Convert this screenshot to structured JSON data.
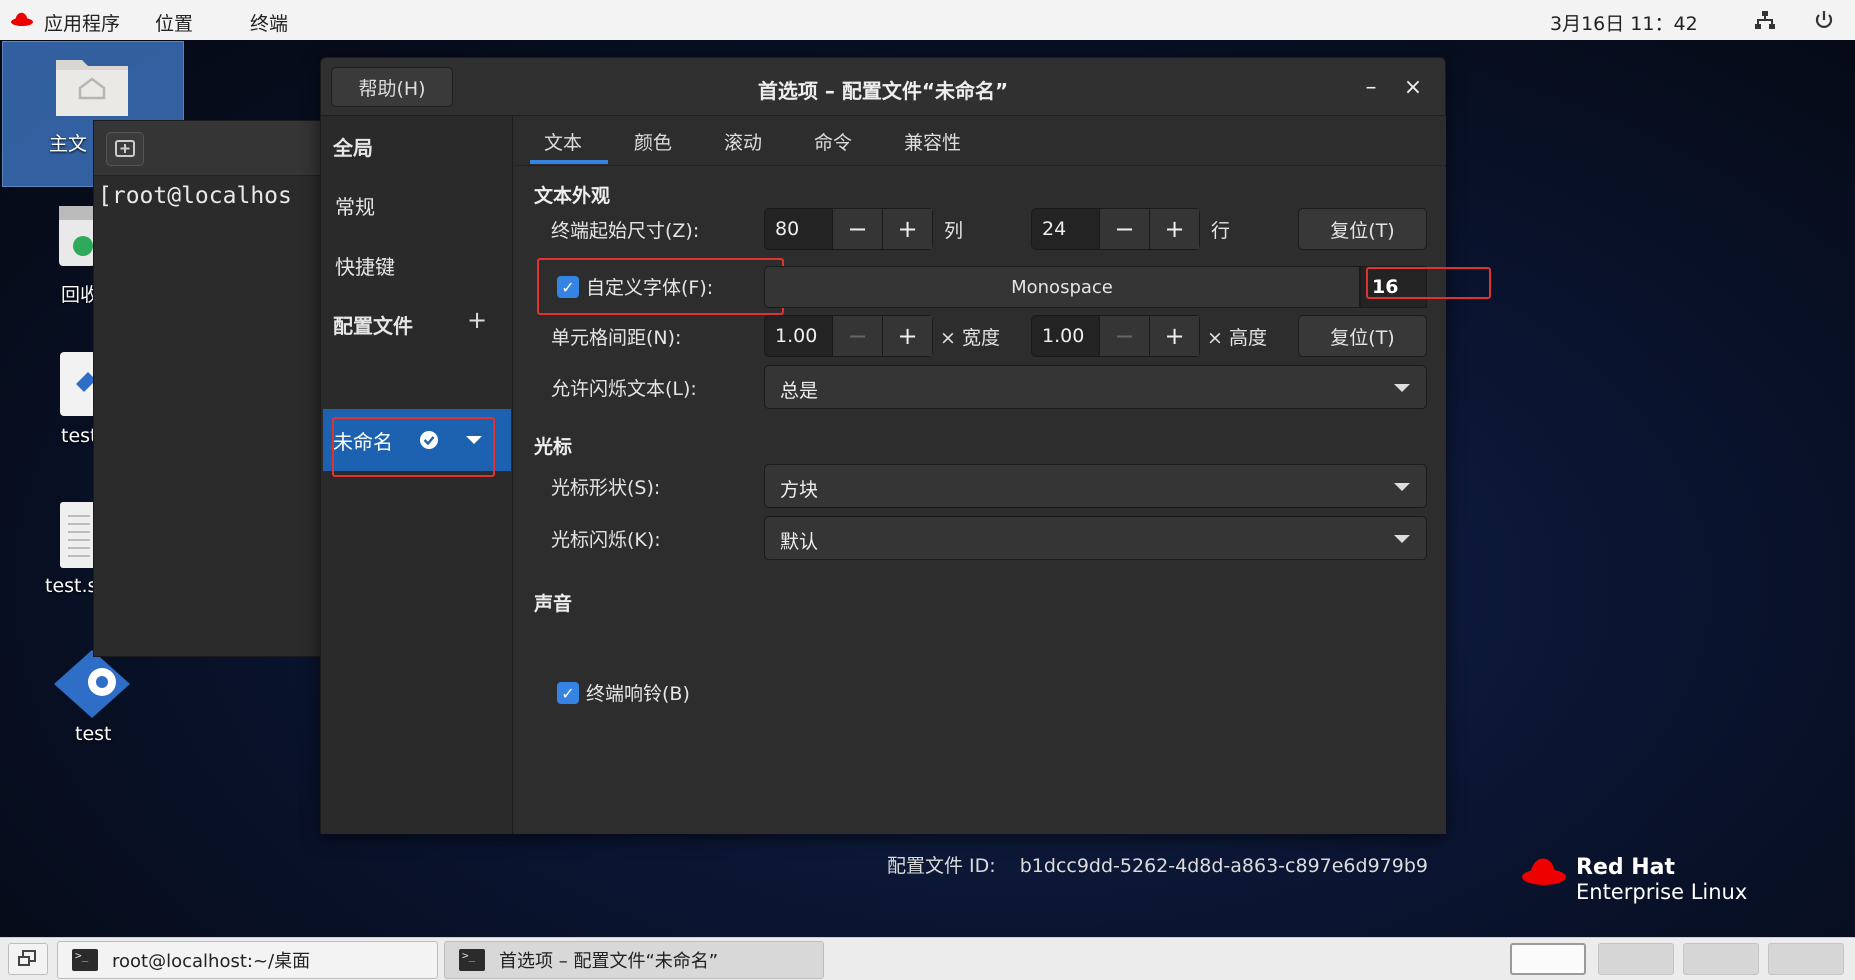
{
  "topbar": {
    "apps": "应用程序",
    "places": "位置",
    "terminal": "终端",
    "clock": "3月16日  11：42"
  },
  "desktop": {
    "icons": [
      {
        "label": "主文"
      },
      {
        "label": "回收"
      },
      {
        "label": "test"
      },
      {
        "label": "test.s"
      },
      {
        "label": "test"
      }
    ]
  },
  "terminal": {
    "prompt": "[root@localhos"
  },
  "dialog": {
    "help_label": "帮助(H)",
    "title": "首选项 – 配置文件“未命名”",
    "minimize": "–",
    "close": "×",
    "sidebar": {
      "global": "全局",
      "general": "常规",
      "shortcuts": "快捷键",
      "profiles": "配置文件",
      "add": "+",
      "profile_name": "未命名"
    },
    "tabs": [
      "文本",
      "颜色",
      "滚动",
      "命令",
      "兼容性"
    ],
    "text_appearance": {
      "section": "文本外观",
      "size_label": "终端起始尺寸(Z):",
      "columns": "80",
      "columns_unit": "列",
      "rows": "24",
      "rows_unit": "行",
      "reset1": "复位(T)",
      "custom_font_label": "自定义字体(F):",
      "font_name": "Monospace",
      "font_size": "16",
      "spacing_label": "单元格间距(N):",
      "width_value": "1.00",
      "width_unit": "× 宽度",
      "height_value": "1.00",
      "height_unit": "× 高度",
      "reset2": "复位(T)",
      "blink_label": "允许闪烁文本(L):",
      "blink_value": "总是"
    },
    "cursor": {
      "section": "光标",
      "shape_label": "光标形状(S):",
      "shape_value": "方块",
      "blink_label": "光标闪烁(K):",
      "blink_value": "默认"
    },
    "sound": {
      "section": "声音",
      "bell_label": "终端响铃(B)"
    },
    "profile_id_label": "配置文件 ID:",
    "profile_id": "b1dcc9dd-5262-4d8d-a863-c897e6d979b9"
  },
  "branding": {
    "line1": "Red Hat",
    "line2": "Enterprise Linux"
  },
  "taskbar": {
    "task1": "root@localhost:~/桌面",
    "task2": "首选项 – 配置文件“未命名”"
  },
  "colors": {
    "accent": "#3584e4",
    "selection": "#1c62b0",
    "highlight_box": "#e0322f"
  }
}
